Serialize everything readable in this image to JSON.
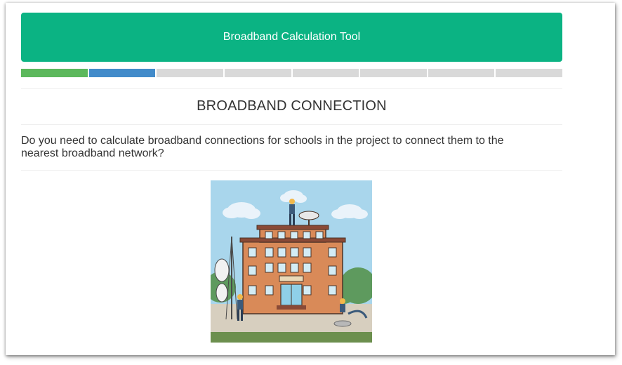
{
  "header": {
    "title": "Broadband Calculation Tool"
  },
  "progress": {
    "total_steps": 8,
    "completed_steps": 1,
    "current_step": 2,
    "colors": {
      "completed": "#5cb85c",
      "current": "#428bca",
      "pending": "#d9d9d9"
    }
  },
  "section": {
    "title": "BROADBAND CONNECTION",
    "question": "Do you need to calculate broadband connections for schools in the project to connect them to the nearest broadband network?"
  },
  "illustration": {
    "icon": "school-broadband-installation-illustration"
  },
  "colors": {
    "accent": "#0bb383",
    "text": "#333333"
  }
}
